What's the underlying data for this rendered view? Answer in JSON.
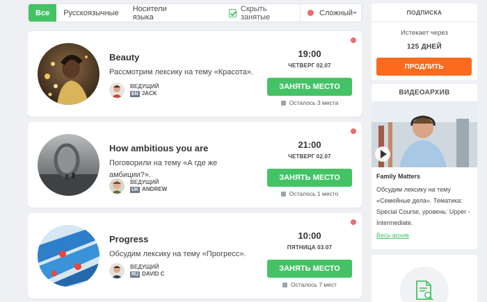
{
  "filters": {
    "tabs": [
      "Все",
      "Русскоязычные",
      "Носители языка"
    ],
    "hide_taken_label": "Скрыть занятые",
    "level_label": "Сложный"
  },
  "lessons": [
    {
      "title": "Beauty",
      "description": "Рассмотрим лексику на тему «Красота».",
      "teacher_label": "ВЕДУЩИЙ",
      "teacher_lang": "EN",
      "teacher_name": "JACK",
      "time": "19:00",
      "date": "ЧЕТВЕРГ 02.07",
      "button": "ЗАНЯТЬ МЕСТО",
      "seats": "Осталось 3 места"
    },
    {
      "title": "How ambitious you are",
      "description": "Поговорили на тему «А где же амбиции?».",
      "teacher_label": "ВЕДУЩИЙ",
      "teacher_lang": "UK",
      "teacher_name": "ANDREW",
      "time": "21:00",
      "date": "ЧЕТВЕРГ 02.07",
      "button": "ЗАНЯТЬ МЕСТО",
      "seats": "Осталось 1 место"
    },
    {
      "title": "Progress",
      "description": "Обсудим лексику на тему «Прогресс».",
      "teacher_label": "ВЕДУЩИЙ",
      "teacher_lang": "RU",
      "teacher_name": "DAVID C",
      "time": "10:00",
      "date": "ПЯТНИЦА 03.07",
      "button": "ЗАНЯТЬ МЕСТО",
      "seats": "Осталось 7 мест"
    }
  ],
  "subscription": {
    "heading": "ПОДПИСКА",
    "expires_label": "Истекает через",
    "days": "125 ДНЕЙ",
    "button": "ПРОДЛИТЬ"
  },
  "video_archive": {
    "heading": "ВИДЕОАРХИВ",
    "title": "Family Matters",
    "description": "Обсудим лексику на тему «Семейные дела». Тематика: Special Course, уровень: Upper - Intermediate.",
    "link": "Весь архив"
  },
  "colors": {
    "accent_green": "#45c266",
    "accent_orange": "#fa6b1e",
    "status_red": "#ec6b6b"
  }
}
